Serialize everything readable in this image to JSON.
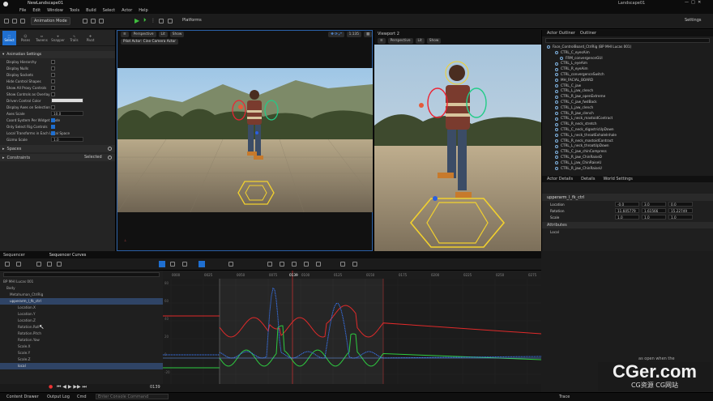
{
  "app": {
    "project_tab": "NewLandscape01",
    "window_title": "Landscape01"
  },
  "menu": [
    "File",
    "Edit",
    "Window",
    "Tools",
    "Build",
    "Select",
    "Actor",
    "Help"
  ],
  "toolbar": {
    "mode": "Animation Mode",
    "platforms": "Platforms",
    "settings": "Settings"
  },
  "left_panel": {
    "modes": [
      "Select",
      "Poses",
      "Tweens",
      "Snapper",
      "Trails",
      "Pivot"
    ],
    "section": "Animation Settings",
    "props": [
      {
        "label": "Display Hierarchy",
        "type": "cb",
        "on": false
      },
      {
        "label": "Display Nulls",
        "type": "cb",
        "on": false
      },
      {
        "label": "Display Sockets",
        "type": "cb",
        "on": false
      },
      {
        "label": "Hide Control Shapes",
        "type": "cb",
        "on": false
      },
      {
        "label": "Show All Proxy Controls",
        "type": "cb",
        "on": false
      },
      {
        "label": "Show Controls as Overlay",
        "type": "cb",
        "on": false
      },
      {
        "label": "Driven Control Color",
        "type": "color"
      },
      {
        "label": "Display Axes on Selection",
        "type": "cb",
        "on": false
      },
      {
        "label": "Axes Scale",
        "type": "val",
        "value": "10.0"
      },
      {
        "label": "Coord System Per Widget Mode",
        "type": "cb",
        "on": true
      },
      {
        "label": "Only Select Rig Controls",
        "type": "cb",
        "on": true
      },
      {
        "label": "Local Transforms in Each Local Space",
        "type": "cb",
        "on": true
      },
      {
        "label": "Gizmo Scale",
        "type": "val",
        "value": "1.0"
      }
    ],
    "spaces": "Spaces",
    "constraints": "Constraints",
    "selected": "Selected"
  },
  "viewport1": {
    "mode": "Perspective",
    "lit": "Lit",
    "show": "Show",
    "pilot": "Pilot Actor: Cine Camera Actor",
    "fov": "1.135"
  },
  "viewport2": {
    "tab": "Viewport 2",
    "mode": "Perspective",
    "lit": "Lit",
    "show": "Show"
  },
  "outliner": {
    "tabs": [
      "Actor Outliner",
      "Outliner"
    ],
    "items": [
      "Face_ControlBoard_CtrlRig (BP MHI Lucas 001)",
      "CTRL_C_eyesAim",
      "FRM_convergenceGUI",
      "CTRL_L_eyeAim",
      "CTRL_R_eyeAim",
      "CTRL_convergenceSwitch",
      "MH_FACIAL_BOARD",
      "CTRL_C_jaw",
      "CTRL_L_jaw_clench",
      "CTRL_R_jaw_openExtreme",
      "CTRL_C_jaw_fwdBack",
      "CTRL_L_jaw_clench",
      "CTRL_R_jaw_clench",
      "CTRL_L_neck_mastoidContract",
      "CTRL_R_neck_stretch",
      "CTRL_C_neck_digastricUpDown",
      "CTRL_L_neck_throatExhaleInhale",
      "CTRL_R_neck_mastoidContract",
      "CTRL_L_neck_throatUpDown",
      "CTRL_C_jaw_chinCompress",
      "CTRL_R_jaw_ChinRaiseD",
      "CTRL_L_jaw_ChinRaiseU",
      "CTRL_R_jaw_ChinRaiseU"
    ]
  },
  "details": {
    "tabs": [
      "Actor Details",
      "Details",
      "World Settings"
    ],
    "header": "upperarm_l_fk_ctrl",
    "location": [
      "-0.0",
      "3.0",
      "0.0"
    ],
    "rotation": [
      "11.605779",
      "1.61566",
      "15.22749"
    ],
    "scale": [
      "1.0",
      "1.0",
      "1.0"
    ],
    "attributes": "Attributes",
    "attr_label": "Local"
  },
  "sequencer": {
    "tabs": [
      "Sequencer",
      "Sequencer Curves"
    ],
    "frame": "0139",
    "tree": [
      "BP MHI Lucas 001",
      "Body",
      "Metahuman_CtrlRig",
      "upperarm_l_fk_ctrl",
      "Location.X",
      "Location.Y",
      "Location.Z",
      "Rotation.Roll",
      "Rotation.Pitch",
      "Rotation.Yaw",
      "Scale.X",
      "Scale.Y",
      "Scale.Z",
      "local"
    ],
    "ruler": [
      "0000",
      "0025",
      "0050",
      "0075",
      "0100",
      "0125",
      "0150",
      "0175",
      "0200",
      "0225",
      "0250",
      "0275"
    ],
    "yvals": [
      "80",
      "60",
      "40",
      "20",
      "0",
      "-20"
    ],
    "end_frame": "0139",
    "notice": "as open when the"
  },
  "status": {
    "drawer": "Content Drawer",
    "log": "Output Log",
    "cmd": "Cmd",
    "console": "Enter Console Command",
    "trace": "Trace"
  },
  "watermark": {
    "big": "CGer.com",
    "small": "CG资源 CG网站"
  }
}
